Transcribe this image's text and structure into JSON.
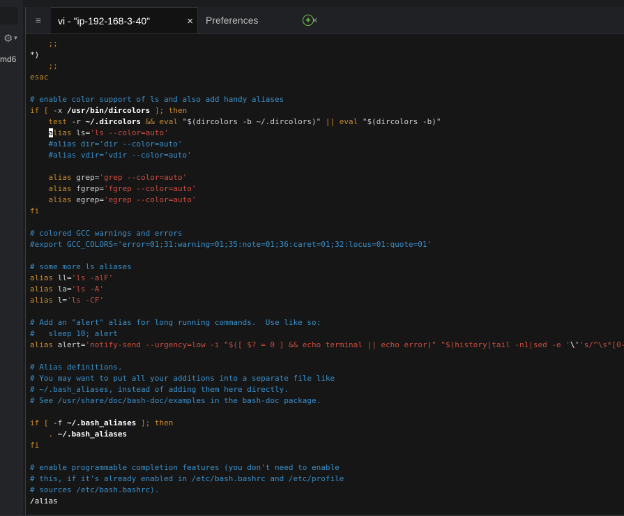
{
  "sidebar": {
    "label": "md6",
    "gear_icon": "gear-icon"
  },
  "tabs": [
    {
      "label": "vi - \"ip-192-168-3-40\"",
      "active": true
    },
    {
      "label": "Preferences",
      "active": false
    }
  ],
  "tab_close": "×",
  "add_tab": "+",
  "menu_icon": "≡",
  "editor": {
    "lines": [
      [
        [
          "k",
          "    ;;"
        ]
      ],
      [
        [
          "w",
          "*)"
        ]
      ],
      [
        [
          "k",
          "    ;;"
        ]
      ],
      [
        [
          "k",
          "esac"
        ]
      ],
      [],
      [
        [
          "c",
          "# enable color support of ls and also add handy aliases"
        ]
      ],
      [
        [
          "k",
          "if [ "
        ],
        [
          "d",
          "-x "
        ],
        [
          "b",
          "/usr/bin/dircolors"
        ],
        [
          "k",
          " ]; then"
        ]
      ],
      [
        [
          "k",
          "    test "
        ],
        [
          "d",
          "-r "
        ],
        [
          "b",
          "~/.dircolors"
        ],
        [
          "k",
          " && eval "
        ],
        [
          "d",
          "\"$(dircolors -b ~/.dircolors)\""
        ],
        [
          "k",
          " || eval "
        ],
        [
          "d",
          "\"$(dircolors -b)\""
        ]
      ],
      [
        [
          "d",
          "    "
        ],
        [
          "cur",
          "a"
        ],
        [
          "k",
          "lias "
        ],
        [
          "d",
          "ls="
        ],
        [
          "s",
          "'ls --color=auto'"
        ]
      ],
      [
        [
          "c",
          "    #alias dir='dir --color=auto'"
        ]
      ],
      [
        [
          "c",
          "    #alias vdir='vdir --color=auto'"
        ]
      ],
      [],
      [
        [
          "k",
          "    alias "
        ],
        [
          "d",
          "grep="
        ],
        [
          "s",
          "'grep --color=auto'"
        ]
      ],
      [
        [
          "k",
          "    alias "
        ],
        [
          "d",
          "fgrep="
        ],
        [
          "s",
          "'fgrep --color=auto'"
        ]
      ],
      [
        [
          "k",
          "    alias "
        ],
        [
          "d",
          "egrep="
        ],
        [
          "s",
          "'egrep --color=auto'"
        ]
      ],
      [
        [
          "k",
          "fi"
        ]
      ],
      [],
      [
        [
          "c",
          "# colored GCC warnings and errors"
        ]
      ],
      [
        [
          "c",
          "#export GCC_COLORS='error=01;31:warning=01;35:note=01;36:caret=01;32:locus=01:quote=01'"
        ]
      ],
      [],
      [
        [
          "c",
          "# some more ls aliases"
        ]
      ],
      [
        [
          "k",
          "alias "
        ],
        [
          "d",
          "ll="
        ],
        [
          "s",
          "'ls -alF'"
        ]
      ],
      [
        [
          "k",
          "alias "
        ],
        [
          "d",
          "la="
        ],
        [
          "s",
          "'ls -A'"
        ]
      ],
      [
        [
          "k",
          "alias "
        ],
        [
          "d",
          "l="
        ],
        [
          "s",
          "'ls -CF'"
        ]
      ],
      [],
      [
        [
          "c",
          "# Add an \"alert\" alias for long running commands.  Use like so:"
        ]
      ],
      [
        [
          "c",
          "#   sleep 10; alert"
        ]
      ],
      [
        [
          "k",
          "alias "
        ],
        [
          "d",
          "alert="
        ],
        [
          "s",
          "'notify-send --urgency=low -i \"$([ $? = 0 ] && echo terminal || echo error)\" \"$(history|tail -n1|sed -e '"
        ],
        [
          "w",
          "\\'"
        ],
        [
          "s",
          "'s/^\\s*[0-"
        ]
      ],
      [],
      [
        [
          "c",
          "# Alias definitions."
        ]
      ],
      [
        [
          "c",
          "# You may want to put all your additions into a separate file like"
        ]
      ],
      [
        [
          "c",
          "# ~/.bash_aliases, instead of adding them here directly."
        ]
      ],
      [
        [
          "c",
          "# See /usr/share/doc/bash-doc/examples in the bash-doc package."
        ]
      ],
      [],
      [
        [
          "k",
          "if [ "
        ],
        [
          "d",
          "-f "
        ],
        [
          "b",
          "~/.bash_aliases"
        ],
        [
          "k",
          " ]; then"
        ]
      ],
      [
        [
          "k",
          "    . "
        ],
        [
          "b",
          "~/.bash_aliases"
        ]
      ],
      [
        [
          "k",
          "fi"
        ]
      ],
      [],
      [
        [
          "c",
          "# enable programmable completion features (you don't need to enable"
        ]
      ],
      [
        [
          "c",
          "# this, if it's already enabled in /etc/bash.bashrc and /etc/profile"
        ]
      ],
      [
        [
          "c",
          "# sources /etc/bash.bashrc)."
        ]
      ],
      [
        [
          "w",
          "/alias"
        ]
      ]
    ]
  }
}
